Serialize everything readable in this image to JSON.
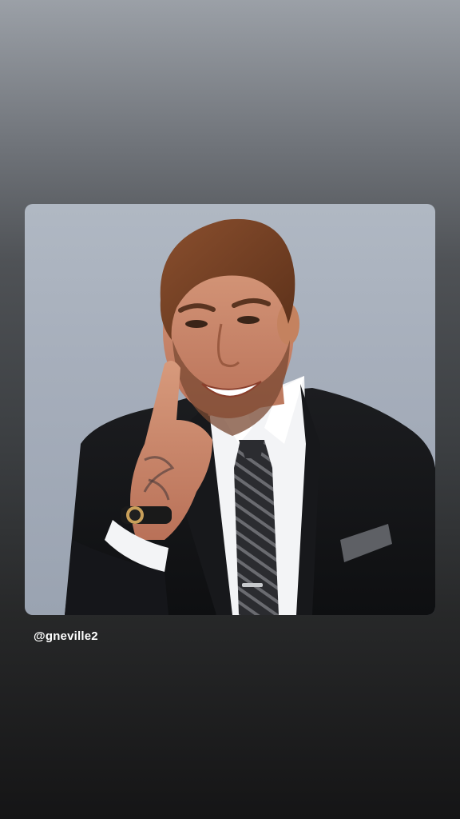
{
  "story": {
    "mention_handle": "@gneville2"
  }
}
